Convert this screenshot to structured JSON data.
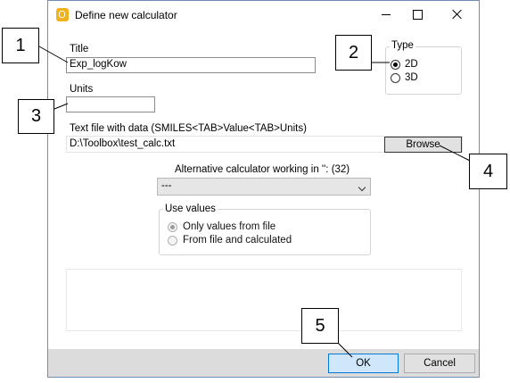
{
  "window": {
    "title": "Define new calculator",
    "icon": "app-q-icon"
  },
  "form": {
    "title_label": "Title",
    "title_value": "Exp_logKow",
    "units_label": "Units",
    "units_value": "",
    "file_label": "Text file with data (SMILES<TAB>Value<TAB>Units)",
    "file_value": "D:\\Toolbox\\test_calc.txt",
    "browse_label": "Browse",
    "alt_calc_label": "Alternative calculator working in '': (32)",
    "alt_calc_value": "---"
  },
  "type_group": {
    "title": "Type",
    "options": [
      {
        "label": "2D",
        "selected": true
      },
      {
        "label": "3D",
        "selected": false
      }
    ]
  },
  "use_values_group": {
    "title": "Use values",
    "options": [
      {
        "label": "Only values from file",
        "selected": true
      },
      {
        "label": "From file and calculated",
        "selected": false
      }
    ]
  },
  "buttons": {
    "ok": "OK",
    "cancel": "Cancel"
  },
  "callouts": [
    "1",
    "2",
    "3",
    "4",
    "5"
  ],
  "colors": {
    "ok_border": "#0078d7",
    "ok_fill": "#d0e7fb",
    "footer": "#dcdcdc",
    "app_icon": "#f0b31b"
  }
}
